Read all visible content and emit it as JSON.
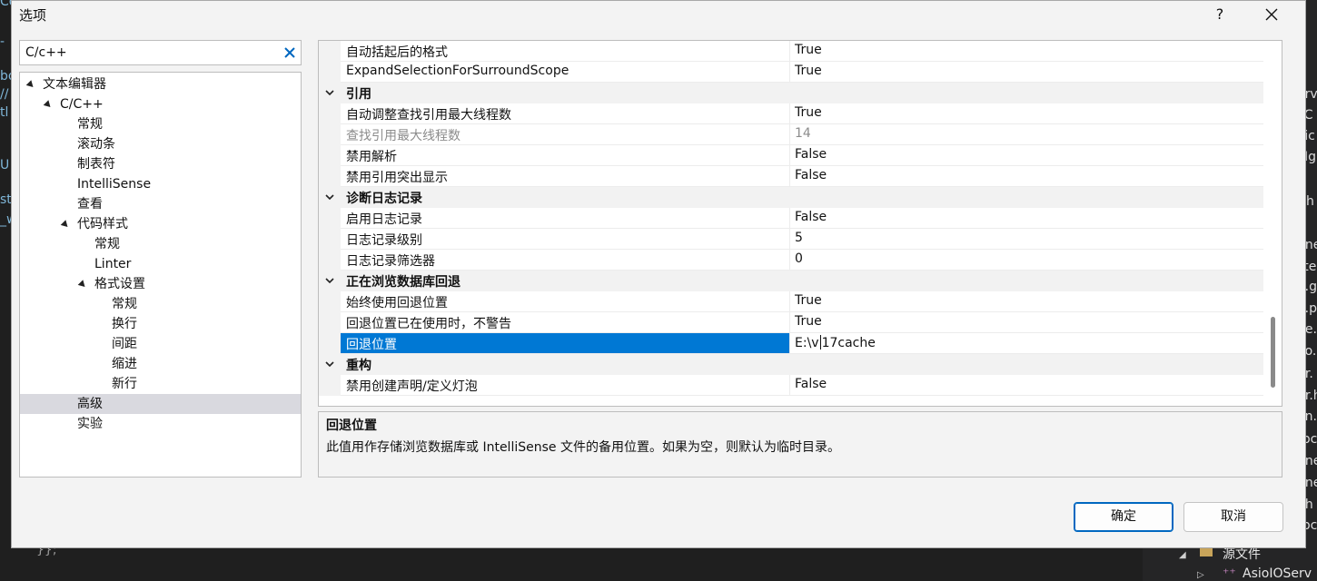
{
  "dialog": {
    "title": "选项",
    "help_label": "?"
  },
  "search": {
    "value": "C/c++"
  },
  "tree": [
    {
      "label": "文本编辑器",
      "expanded": true
    },
    {
      "label": "C/C++",
      "expanded": true
    },
    {
      "label": "常规"
    },
    {
      "label": "滚动条"
    },
    {
      "label": "制表符"
    },
    {
      "label": "IntelliSense"
    },
    {
      "label": "查看"
    },
    {
      "label": "代码样式",
      "expanded": true
    },
    {
      "label": "常规"
    },
    {
      "label": "Linter"
    },
    {
      "label": "格式设置",
      "expanded": true
    },
    {
      "label": "常规"
    },
    {
      "label": "换行"
    },
    {
      "label": "间距"
    },
    {
      "label": "缩进"
    },
    {
      "label": "新行"
    },
    {
      "label": "高级",
      "selected": true
    },
    {
      "label": "实验"
    }
  ],
  "properties": [
    {
      "name": "自动括起后的格式",
      "value": "True"
    },
    {
      "name": "ExpandSelectionForSurroundScope",
      "value": "True"
    },
    {
      "category": "引用"
    },
    {
      "name": "自动调整查找引用最大线程数",
      "value": "True"
    },
    {
      "name": "查找引用最大线程数",
      "value": "14",
      "disabled": true
    },
    {
      "name": "禁用解析",
      "value": "False"
    },
    {
      "name": "禁用引用突出显示",
      "value": "False"
    },
    {
      "category": "诊断日志记录"
    },
    {
      "name": "启用日志记录",
      "value": "False"
    },
    {
      "name": "日志记录级别",
      "value": "5"
    },
    {
      "name": "日志记录筛选器",
      "value": "0"
    },
    {
      "category": "正在浏览数据库回退"
    },
    {
      "name": "始终使用回退位置",
      "value": "True"
    },
    {
      "name": "回退位置已在使用时，不警告",
      "value": "True"
    },
    {
      "name": "回退位置",
      "value": "E:\\v17cache",
      "selected": true
    },
    {
      "category": "重构"
    },
    {
      "name": "禁用创建声明/定义灯泡",
      "value": "False"
    }
  ],
  "selected_value": {
    "before_caret": "E:\\v",
    "after_caret": "17cache"
  },
  "description": {
    "title": "回退位置",
    "text": "此值用作存储浏览数据库或 IntelliSense 文件的备用位置。如果为空，则默认为临时目录。"
  },
  "buttons": {
    "ok": "确定",
    "cancel": "取消"
  },
  "background": {
    "right_fragments": [
      "erv",
      "cC",
      "vic",
      "Mgr",
      "t.h",
      "nne",
      "ste",
      "e.g",
      "e.p",
      "de.l",
      "ao.l",
      "gr.",
      "gr.h",
      "on.h",
      "rpc",
      "nne",
      "nne",
      "r.h",
      "rpc"
    ],
    "left_fragments": [
      "Co",
      "-",
      "bo",
      "//",
      "tl",
      "U",
      "st",
      "_w"
    ],
    "bottom_braces": "}};",
    "solution_folder": "源文件",
    "solution_file": "AsioIOServ"
  }
}
